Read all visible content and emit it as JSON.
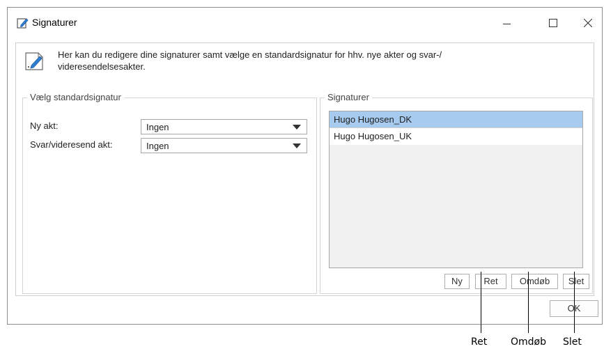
{
  "window": {
    "title": "Signaturer"
  },
  "info": {
    "text": "Her kan du redigere dine signaturer samt vælge en standardsignatur for hhv. nye akter og svar-/ videresendelsesakter."
  },
  "defaults_group": {
    "legend": "Vælg standardsignatur",
    "fields": [
      {
        "label": "Ny akt:",
        "value": "Ingen"
      },
      {
        "label": "Svar/videresend akt:",
        "value": "Ingen"
      }
    ]
  },
  "signatures_group": {
    "legend": "Signaturer",
    "items": [
      "Hugo Hugosen_DK",
      "Hugo Hugosen_UK"
    ],
    "selected_index": 0,
    "buttons": {
      "new": "Ny",
      "edit": "Ret",
      "rename": "Omdøb",
      "delete": "Slet"
    }
  },
  "footer": {
    "ok": "OK"
  },
  "callouts": [
    "Ret",
    "Omdøb",
    "Slet"
  ],
  "colors": {
    "selected_row": "#a6cbee",
    "list_background": "#f0f0f0"
  }
}
